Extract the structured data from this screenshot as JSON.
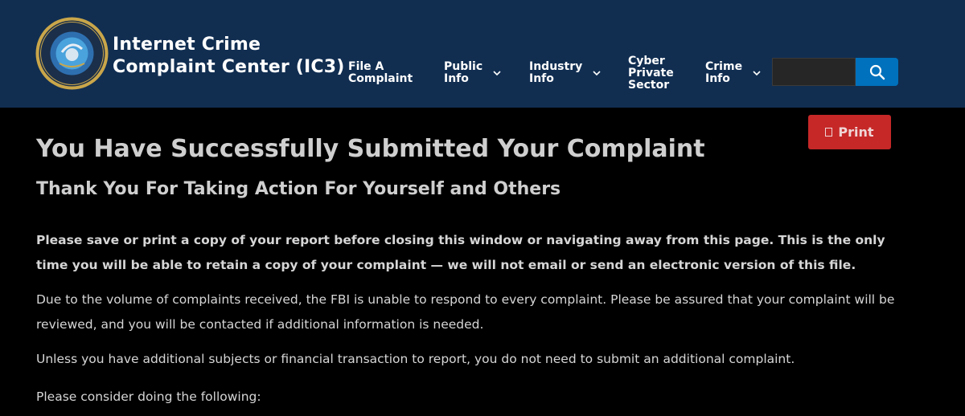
{
  "header": {
    "brand_line1": "Internet Crime",
    "brand_line2": "Complaint Center (IC3)",
    "nav": [
      {
        "line1": "File A",
        "line2": "Complaint",
        "line3": ""
      },
      {
        "line1": "Public",
        "line2": "Info",
        "line3": ""
      },
      {
        "line1": "Industry",
        "line2": "Info",
        "line3": ""
      },
      {
        "line1": "Cyber",
        "line2": "Private",
        "line3": "Sector"
      },
      {
        "line1": "Crime",
        "line2": "Info",
        "line3": ""
      }
    ],
    "search": {
      "value": "",
      "placeholder": ""
    }
  },
  "print_button": {
    "label": "Print"
  },
  "content": {
    "title": "You Have Successfully Submitted Your Complaint",
    "subtitle": "Thank You For Taking Action For Yourself and Others",
    "notice_bold": "Please save or print a copy of your report before closing this window or navigating away from this page. This is the only time you will be able to retain a copy of your complaint — we will not email or send an electronic version of this file.",
    "para1": "Due to the volume of complaints received, the FBI is unable to respond to every complaint. Please be assured that your complaint will be reviewed, and you will be contacted if additional information is needed.",
    "para2": "Unless you have additional subjects or financial transaction to report, you do not need to submit an additional complaint.",
    "para3": "Please consider doing the following:"
  },
  "colors": {
    "header_bg": "#112e51",
    "page_bg": "#000000",
    "search_button": "#0071bc",
    "print_button": "#c62828"
  },
  "icons": [
    "ic3-seal-logo",
    "chevron-down-icon",
    "search-icon",
    "print-icon"
  ]
}
